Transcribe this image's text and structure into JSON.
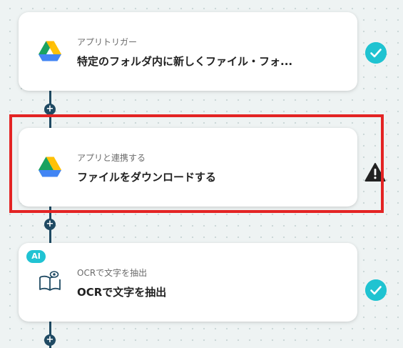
{
  "steps": [
    {
      "subtitle": "アプリトリガー",
      "title": "特定のフォルダ内に新しくファイル・フォ...",
      "icon": "google-drive-icon",
      "status": "complete"
    },
    {
      "subtitle": "アプリと連携する",
      "title": "ファイルをダウンロードする",
      "icon": "google-drive-icon",
      "status": "warning",
      "highlighted": true
    },
    {
      "badge": "AI",
      "subtitle": "OCRで文字を抽出",
      "title": "OCRで文字を抽出",
      "icon": "book-eye-icon",
      "status": "complete"
    }
  ],
  "add_step_label": "+",
  "colors": {
    "connector": "#1f4a63",
    "check": "#1fc3d1",
    "ai_badge": "#20c3d3",
    "highlight": "#e32424",
    "warning": "#222222"
  }
}
